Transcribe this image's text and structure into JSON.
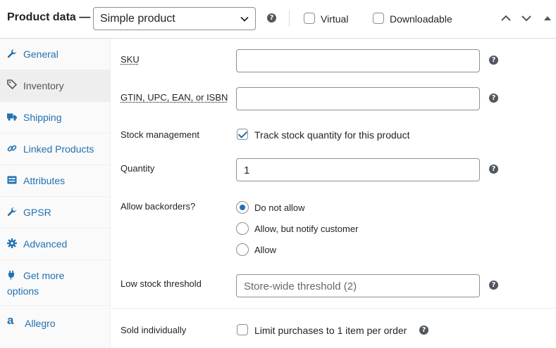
{
  "header": {
    "title": "Product data —",
    "product_type": {
      "selected": "Simple product"
    },
    "virtual_label": "Virtual",
    "virtual_checked": false,
    "downloadable_label": "Downloadable",
    "downloadable_checked": false,
    "help_glyph": "?"
  },
  "sidebar": {
    "tabs": [
      {
        "label": "General",
        "icon": "wrench-icon",
        "active": false
      },
      {
        "label": "Inventory",
        "icon": "tag-icon",
        "active": true
      },
      {
        "label": "Shipping",
        "icon": "truck-icon",
        "active": false
      },
      {
        "label": "Linked Products",
        "icon": "link-icon",
        "active": false
      },
      {
        "label": "Attributes",
        "icon": "list-card-icon",
        "active": false
      },
      {
        "label": "GPSR",
        "icon": "wrench-icon",
        "active": false
      },
      {
        "label": "Advanced",
        "icon": "gear-icon",
        "active": false
      },
      {
        "label_line1": "Get more",
        "label_line2": "options",
        "icon": "plugin-icon",
        "active": false
      },
      {
        "label": "Allegro",
        "icon": "allegro-a-icon",
        "glyph": "a",
        "active": false
      }
    ]
  },
  "inventory": {
    "sku": {
      "label": "SKU",
      "value": ""
    },
    "gtin": {
      "label": "GTIN, UPC, EAN, or ISBN",
      "value": ""
    },
    "stock_management": {
      "label": "Stock management",
      "checkbox_label": "Track stock quantity for this product",
      "checked": true
    },
    "quantity": {
      "label": "Quantity",
      "value": "1"
    },
    "backorders": {
      "label": "Allow backorders?",
      "options": [
        "Do not allow",
        "Allow, but notify customer",
        "Allow"
      ],
      "selected": "Do not allow"
    },
    "low_stock": {
      "label": "Low stock threshold",
      "placeholder": "Store-wide threshold (2)"
    },
    "sold_individually": {
      "label": "Sold individually",
      "checkbox_label": "Limit purchases to 1 item per order",
      "checked": false
    }
  },
  "colors": {
    "accent": "#2271b1",
    "text": "#1d2327",
    "border": "#8c8f94",
    "help_icon": "#50575e",
    "sidebar_bg": "#fafafa",
    "active_tab_bg": "#eeeeee"
  }
}
